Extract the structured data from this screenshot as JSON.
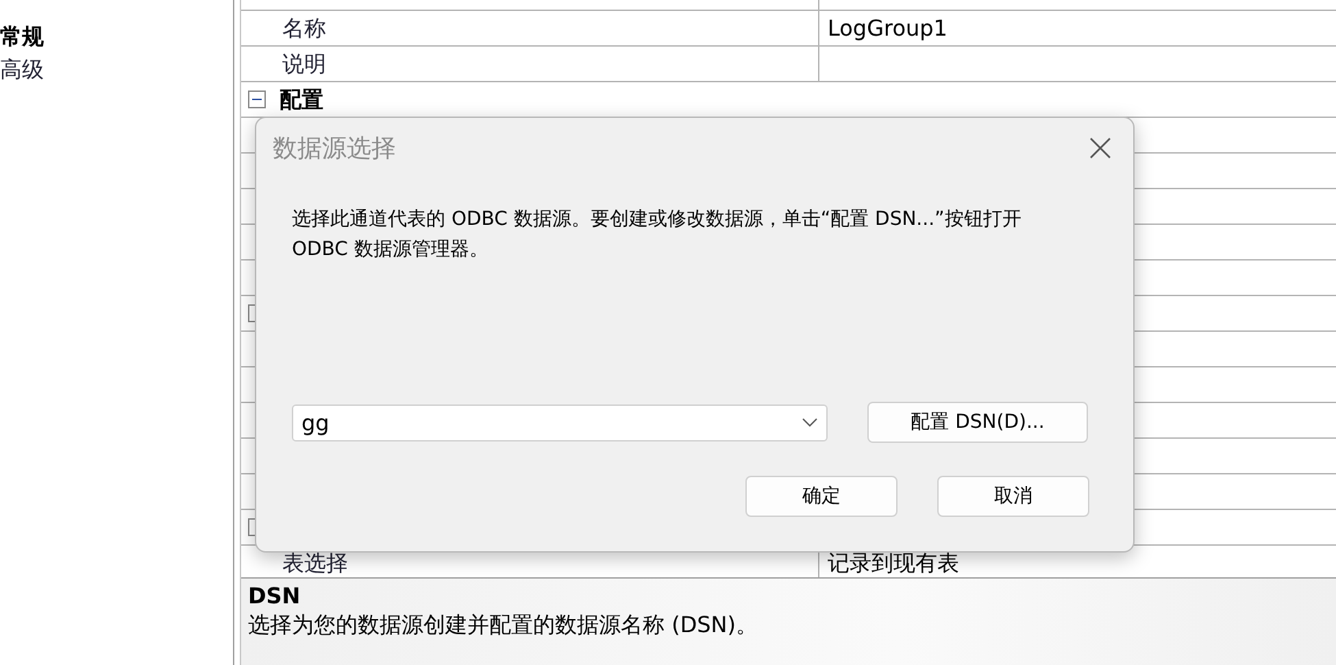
{
  "sidebar": {
    "items": [
      {
        "label": "常规",
        "selected": true
      },
      {
        "label": "高级",
        "selected": false
      }
    ]
  },
  "grid": {
    "rows": [
      {
        "kind": "blank"
      },
      {
        "kind": "property",
        "name": "名称",
        "value": "LogGroup1"
      },
      {
        "kind": "property",
        "name": "说明"
      },
      {
        "kind": "group",
        "label": "配置",
        "expanded": true
      },
      {
        "kind": "blank"
      },
      {
        "kind": "blank"
      },
      {
        "kind": "blank"
      },
      {
        "kind": "blank"
      },
      {
        "kind": "blank"
      },
      {
        "kind": "group"
      },
      {
        "kind": "blank"
      },
      {
        "kind": "blank"
      },
      {
        "kind": "blank"
      },
      {
        "kind": "blank"
      },
      {
        "kind": "blank"
      },
      {
        "kind": "group"
      },
      {
        "kind": "property",
        "name": "表选择",
        "value": "记录到现有表"
      }
    ]
  },
  "description": {
    "title": "DSN",
    "text": "选择为您的数据源创建并配置的数据源名称 (DSN)。"
  },
  "dialog": {
    "title": "数据源选择",
    "message": "选择此通道代表的 ODBC 数据源。要创建或修改数据源，单击“配置 DSN...”按钮打开 ODBC 数据源管理器。",
    "dsn_value": "gg",
    "configure_button": "配置 DSN(D)...",
    "ok_button": "确定",
    "cancel_button": "取消"
  }
}
